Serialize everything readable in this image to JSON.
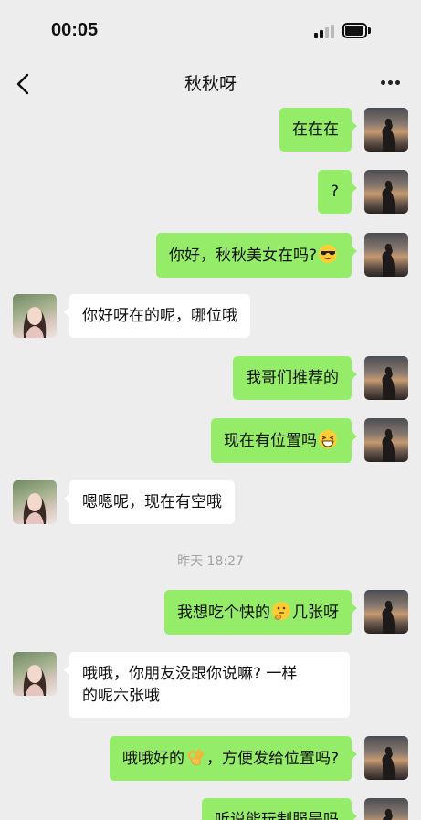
{
  "status_bar": {
    "time": "00:05"
  },
  "nav": {
    "title": "秋秋呀"
  },
  "messages": [
    {
      "id": "m1",
      "side": "out",
      "text": "在在在"
    },
    {
      "id": "m2",
      "side": "out",
      "text": "?"
    },
    {
      "id": "m3",
      "side": "out",
      "text_a": "你好，秋秋美女在吗?",
      "emoji": "sunglasses-face-emoji"
    },
    {
      "id": "m4",
      "side": "in",
      "text": "你好呀在的呢，哪位哦"
    },
    {
      "id": "m5",
      "side": "out",
      "text": "我哥们推荐的"
    },
    {
      "id": "m6",
      "side": "out",
      "text_a": "现在有位置吗",
      "emoji": "grinning-squinting-face-emoji"
    },
    {
      "id": "m7",
      "side": "in",
      "text": "嗯嗯呢，现在有空哦"
    },
    {
      "id": "m8",
      "side": "out",
      "text_a": "我想吃个快的",
      "emoji": "thinking-face-emoji",
      "text_b": "几张呀"
    },
    {
      "id": "m9",
      "side": "in",
      "line1": "哦哦，你朋友没跟你说嘛? 一样",
      "line2": "的呢六张哦"
    },
    {
      "id": "m10",
      "side": "out",
      "text_a": "哦哦好的",
      "emoji": "ok-hand-emoji",
      "text_b": "，方便发给位置吗?"
    },
    {
      "id": "m11",
      "side": "out",
      "text": "听说能玩制服是吗"
    }
  ],
  "timestamp": "昨天 18:27",
  "colors": {
    "bubble_out": "#95ec69",
    "bubble_in": "#ffffff",
    "background": "#ededed"
  }
}
